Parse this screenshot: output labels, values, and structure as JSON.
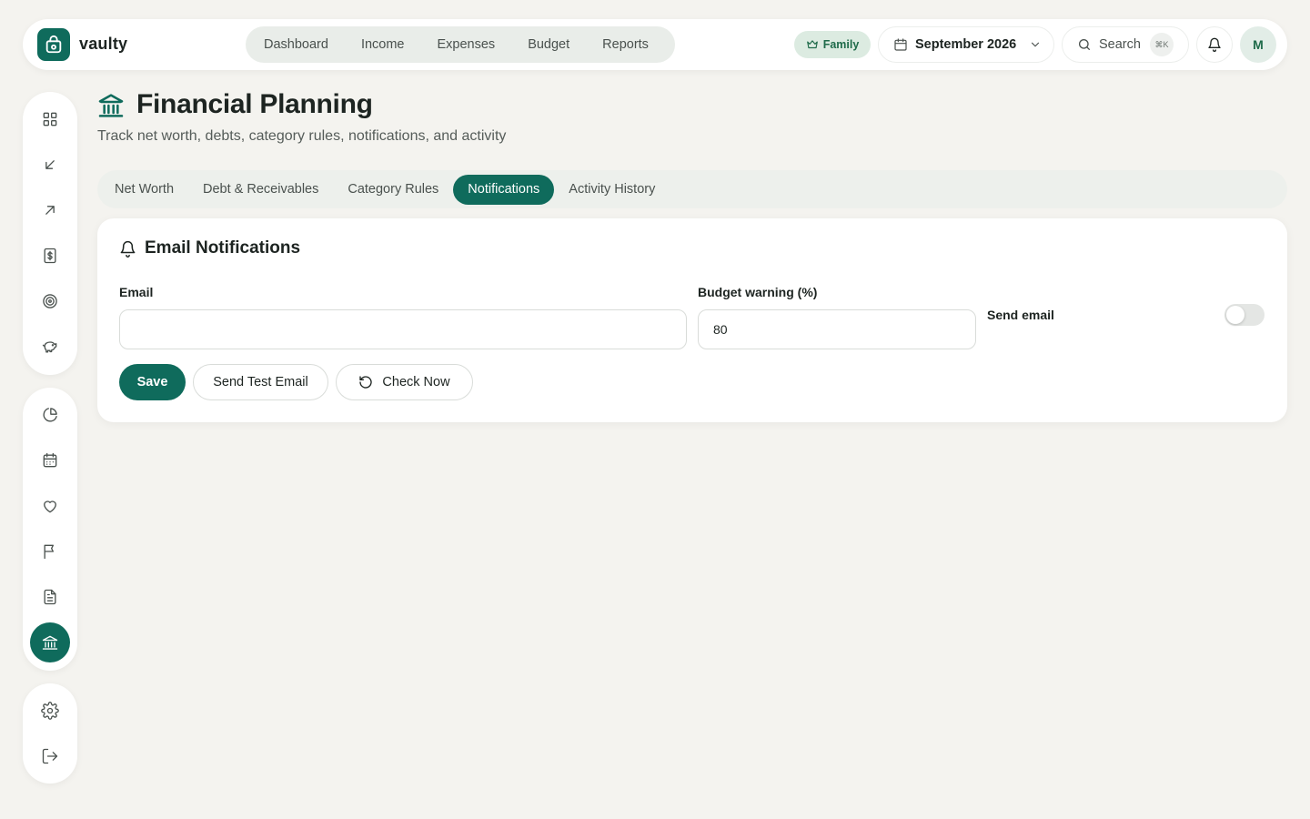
{
  "app": {
    "name": "vaulty"
  },
  "nav": {
    "items": [
      "Dashboard",
      "Income",
      "Expenses",
      "Budget",
      "Reports"
    ]
  },
  "topbar": {
    "plan_badge": "Family",
    "month": "September 2026",
    "search_label": "Search",
    "search_shortcut": "⌘K",
    "avatar_initial": "M"
  },
  "page": {
    "title": "Financial Planning",
    "subtitle": "Track net worth, debts, category rules, notifications, and activity"
  },
  "tabs": [
    {
      "label": "Net Worth",
      "active": false
    },
    {
      "label": "Debt & Receivables",
      "active": false
    },
    {
      "label": "Category Rules",
      "active": false
    },
    {
      "label": "Notifications",
      "active": true
    },
    {
      "label": "Activity History",
      "active": false
    }
  ],
  "notifications": {
    "title": "Email Notifications",
    "email_label": "Email",
    "email_value": "",
    "budget_label": "Budget warning (%)",
    "budget_value": "80",
    "send_email_label": "Send email",
    "send_email_enabled": false,
    "save_label": "Save",
    "test_label": "Send Test Email",
    "check_label": "Check Now"
  },
  "sidebar": {
    "group1": [
      "grid-icon",
      "arrow-down-left-icon",
      "arrow-up-right-icon",
      "dollar-receipt-icon",
      "target-icon",
      "piggy-bank-icon"
    ],
    "group2": [
      "pie-chart-icon",
      "calendar-icon",
      "heart-icon",
      "flag-icon",
      "document-icon",
      "bank-icon"
    ],
    "group3": [
      "gear-icon",
      "logout-icon"
    ],
    "active": "bank-icon"
  },
  "colors": {
    "accent": "#0f6b5c",
    "background": "#f4f3ef"
  }
}
